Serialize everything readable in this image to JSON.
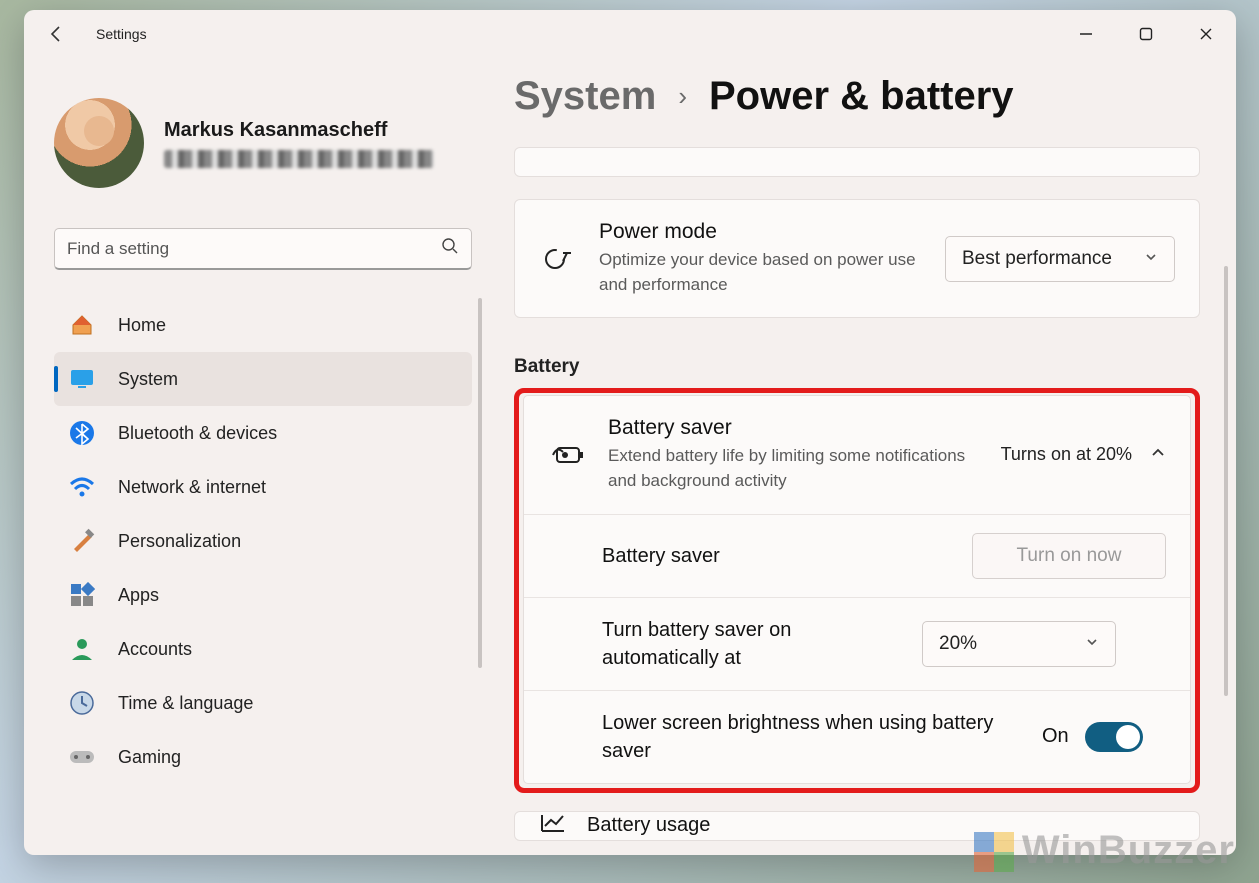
{
  "app": {
    "title": "Settings"
  },
  "profile": {
    "name": "Markus Kasanmascheff"
  },
  "search": {
    "placeholder": "Find a setting"
  },
  "sidebar": {
    "items": [
      {
        "label": "Home"
      },
      {
        "label": "System"
      },
      {
        "label": "Bluetooth & devices"
      },
      {
        "label": "Network & internet"
      },
      {
        "label": "Personalization"
      },
      {
        "label": "Apps"
      },
      {
        "label": "Accounts"
      },
      {
        "label": "Time & language"
      },
      {
        "label": "Gaming"
      }
    ]
  },
  "breadcrumb": {
    "root": "System",
    "page": "Power & battery"
  },
  "power_mode": {
    "title": "Power mode",
    "desc": "Optimize your device based on power use and performance",
    "value": "Best performance"
  },
  "section_battery": "Battery",
  "battery_saver": {
    "title": "Battery saver",
    "desc": "Extend battery life by limiting some notifications and background activity",
    "status": "Turns on at 20%",
    "sub_label": "Battery saver",
    "turn_on_btn": "Turn on now",
    "auto_label": "Turn battery saver on automatically at",
    "auto_value": "20%",
    "brightness_label": "Lower screen brightness when using battery saver",
    "brightness_state": "On"
  },
  "battery_usage": {
    "title": "Battery usage"
  },
  "watermark": "WinBuzzer"
}
